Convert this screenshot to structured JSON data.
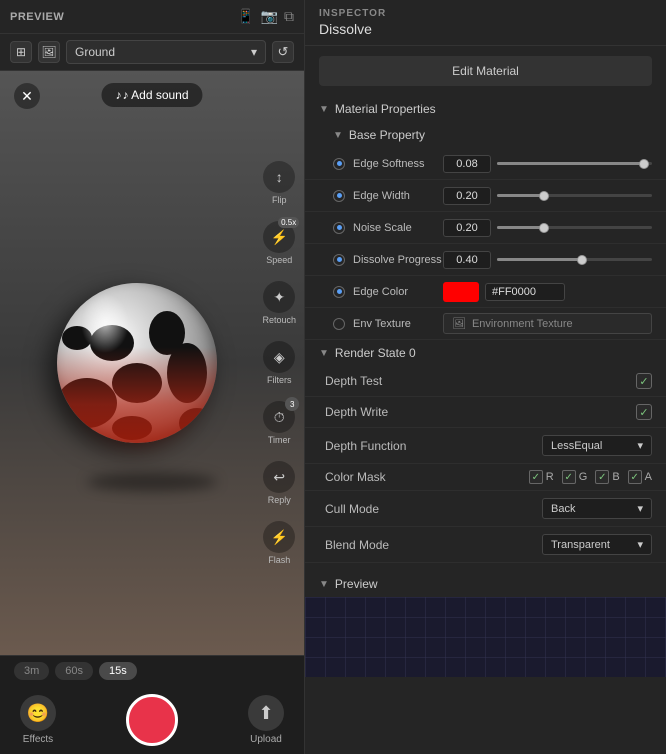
{
  "left": {
    "preview_title": "PREVIEW",
    "ground_option": "Ground",
    "add_sound": "♪  Add sound",
    "tools": [
      {
        "label": "Flip",
        "icon": "↕"
      },
      {
        "label": "Speed",
        "icon": "⚡",
        "badge": "0.5x"
      },
      {
        "label": "Retouch",
        "icon": "✦"
      },
      {
        "label": "Filters",
        "icon": "◈"
      },
      {
        "label": "Timer",
        "icon": "⏱",
        "badge": "3"
      },
      {
        "label": "Reply",
        "icon": "↩"
      },
      {
        "label": "Flash",
        "icon": "⚡"
      }
    ],
    "durations": [
      "3m",
      "60s",
      "15s"
    ],
    "active_duration_index": 2,
    "effects_label": "Effects",
    "upload_label": "Upload"
  },
  "inspector": {
    "title": "INSPECTOR",
    "subtitle": "Dissolve",
    "edit_material_btn": "Edit Material",
    "material_properties": {
      "section_label": "Material Properties",
      "base_property": {
        "section_label": "Base Property",
        "rows": [
          {
            "label": "Edge Softness",
            "value": "0.08",
            "fill_pct": 95
          },
          {
            "label": "Edge Width",
            "value": "0.20",
            "fill_pct": 30
          },
          {
            "label": "Noise Scale",
            "value": "0.20",
            "fill_pct": 30
          },
          {
            "label": "Dissolve Progress",
            "value": "0.40",
            "fill_pct": 55
          }
        ]
      },
      "edge_color": {
        "label": "Edge Color",
        "hex": "#FF0000",
        "color": "#ff0000"
      },
      "env_texture": {
        "label": "Env Texture",
        "placeholder": "Environment Texture"
      }
    },
    "render_state": {
      "section_label": "Render State 0",
      "depth_test": {
        "label": "Depth Test",
        "checked": true
      },
      "depth_write": {
        "label": "Depth Write",
        "checked": true
      },
      "depth_function": {
        "label": "Depth Function",
        "value": "LessEqual"
      },
      "color_mask": {
        "label": "Color Mask",
        "channels": [
          {
            "name": "R",
            "checked": true
          },
          {
            "name": "G",
            "checked": true
          },
          {
            "name": "B",
            "checked": true
          },
          {
            "name": "A",
            "checked": true
          }
        ]
      },
      "cull_mode": {
        "label": "Cull Mode",
        "value": "Back"
      },
      "blend_mode": {
        "label": "Blend Mode",
        "value": "Transparent"
      }
    },
    "preview_section": {
      "label": "Preview"
    }
  }
}
